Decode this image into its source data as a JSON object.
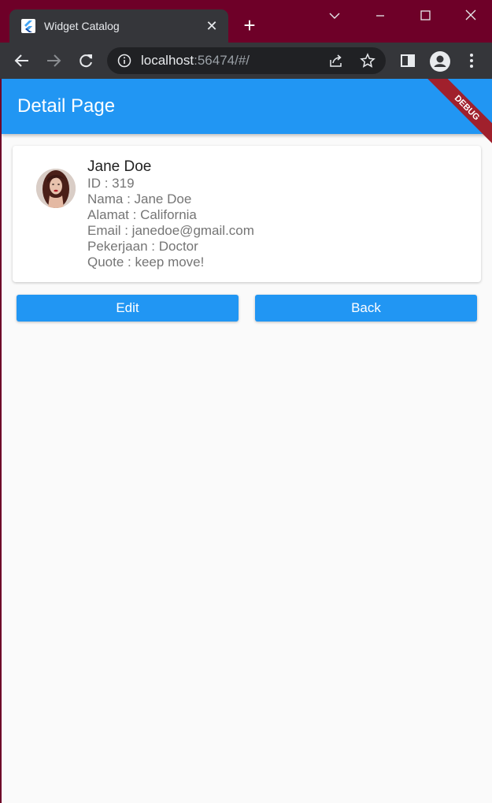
{
  "browser": {
    "tab_title": "Widget Catalog",
    "url_host": "localhost",
    "url_rest": ":56474/#/"
  },
  "app": {
    "title": "Detail Page",
    "debug_banner": "DEBUG",
    "accent_color": "#2196f3"
  },
  "profile": {
    "name": "Jane Doe",
    "lines": [
      "ID : 319",
      "Nama : Jane Doe",
      "Alamat : California",
      "Email : janedoe@gmail.com",
      "Pekerjaan : Doctor",
      "Quote : keep move!"
    ]
  },
  "actions": {
    "edit_label": "Edit",
    "back_label": "Back"
  }
}
